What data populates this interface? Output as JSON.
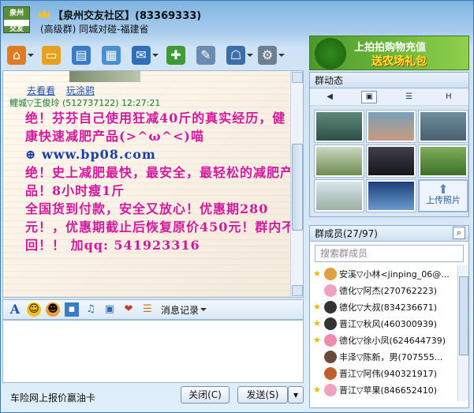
{
  "title": {
    "group_name": "【泉州交友社区】(83369333)",
    "subtitle": "(高级群) 同城对碰-福建省",
    "logo_top": "泉州",
    "logo_bottom": "交友"
  },
  "toolbar": {
    "items": [
      {
        "icon": "home-icon",
        "color": "#e07b22"
      },
      {
        "icon": "folder-icon",
        "color": "#e6a21f"
      },
      {
        "icon": "album-icon",
        "color": "#3a7cc7"
      },
      {
        "icon": "card-icon",
        "color": "#4a8fd0"
      },
      {
        "icon": "mail-icon",
        "color": "#2f6fb5"
      },
      {
        "icon": "plus-icon",
        "color": "#3e9b35"
      },
      {
        "icon": "tools-icon",
        "color": "#6a8cb2"
      },
      {
        "icon": "settings-icon",
        "color": "#3b6fa8"
      },
      {
        "icon": "gear-icon",
        "color": "#6f7f92"
      }
    ]
  },
  "chat": {
    "links": [
      "去看看",
      "玩涂鸦"
    ],
    "sender": "鲤城▽王俊玲 (512737122)  12:27:21",
    "message": [
      "绝！芬芬自己使用狂减40斤的真实经历，健康快速减肥产品(>^ω^<)喵",
      "www.bp08.com",
      "绝！史上减肥最快，最安全，最轻松的减肥产品！8小时瘦1斤",
      "全国货到付款，安全又放心！优惠期280元！，优惠期截止后恢复原价450元！群内不回！！    加qq: 541923316"
    ]
  },
  "input_toolbar": {
    "history_label": "消息记录"
  },
  "bottom": {
    "ad_text": "车险网上报价赢油卡",
    "close_label": "关闭(C)",
    "send_label": "发送(S)"
  },
  "banner": {
    "line1": "上拍拍购物充值",
    "line2": "送农场礼包"
  },
  "dynamics": {
    "header": "群动态",
    "tabs": [
      "◀",
      "▣",
      "☰",
      "H"
    ],
    "upload_label": "上传照片"
  },
  "members": {
    "header": "群成员(27/97)",
    "search_placeholder": "搜索群成员",
    "list": [
      {
        "name": "安溪▽小林<jinping_06@...",
        "star": true,
        "color": "#e0a040"
      },
      {
        "name": "德化▽阿杰(270762223)",
        "star": false,
        "color": "#f0a0c0"
      },
      {
        "name": "德化▽大叔(834236671)",
        "star": true,
        "color": "#333333"
      },
      {
        "name": "晋江▽秋风(460300939)",
        "star": true,
        "color": "#333333"
      },
      {
        "name": "德化▽徐小凤(624644739)",
        "star": true,
        "color": "#f08ab0"
      },
      {
        "name": "丰泽▽陈新，男(707555...",
        "star": false,
        "color": "#6a4a3a"
      },
      {
        "name": "晋江▽阿伟(940321917)",
        "star": false,
        "color": "#c0602a"
      },
      {
        "name": "晋江▽苹果(846652410)",
        "star": true,
        "color": "#f0a0c0"
      }
    ]
  }
}
